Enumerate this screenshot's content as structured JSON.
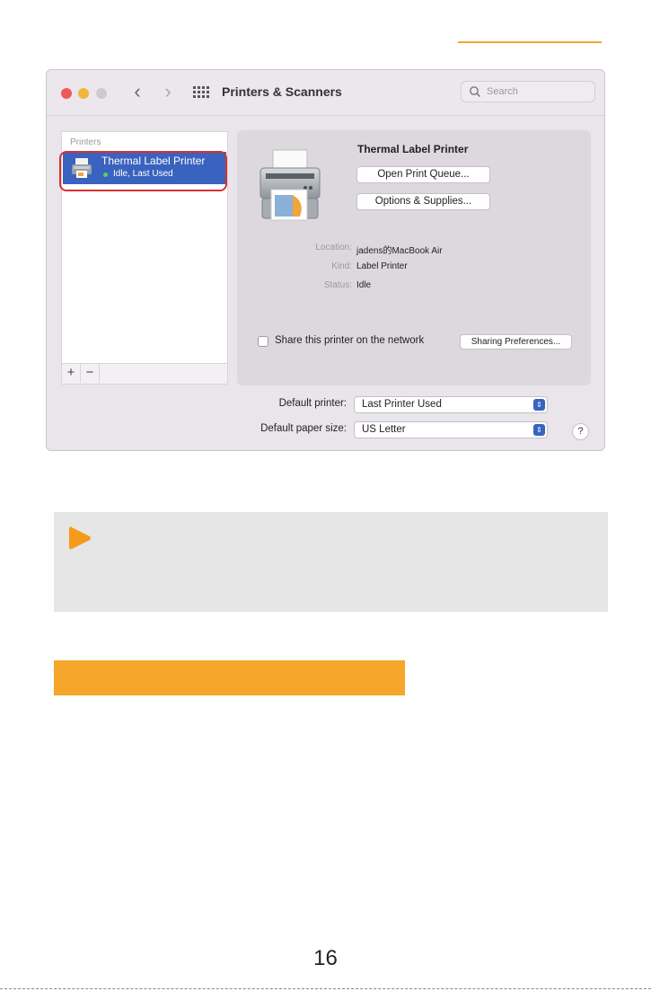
{
  "window": {
    "title": "Printers & Scanners",
    "search_placeholder": "Search"
  },
  "sidebar": {
    "header": "Printers",
    "items": [
      {
        "name": "Thermal Label Printer",
        "status": "Idle, Last Used"
      }
    ],
    "add_label": "+",
    "remove_label": "−"
  },
  "detail": {
    "printer_name": "Thermal Label Printer",
    "open_queue_label": "Open Print Queue...",
    "options_label": "Options & Supplies...",
    "location_label": "Location:",
    "location_value": "jadens的MacBook Air",
    "kind_label": "Kind:",
    "kind_value": "Label Printer",
    "status_label": "Status:",
    "status_value": "Idle",
    "share_label": "Share this printer on the network",
    "share_checked": false,
    "sharing_prefs_label": "Sharing Preferences..."
  },
  "defaults": {
    "printer_label": "Default printer:",
    "printer_value": "Last Printer Used",
    "paper_label": "Default paper size:",
    "paper_value": "US Letter",
    "help_label": "?"
  },
  "page": {
    "number": "16"
  },
  "colors": {
    "accent_orange": "#f5a62b",
    "selection_blue": "#3a62bf",
    "highlight_red": "#d8312f"
  }
}
